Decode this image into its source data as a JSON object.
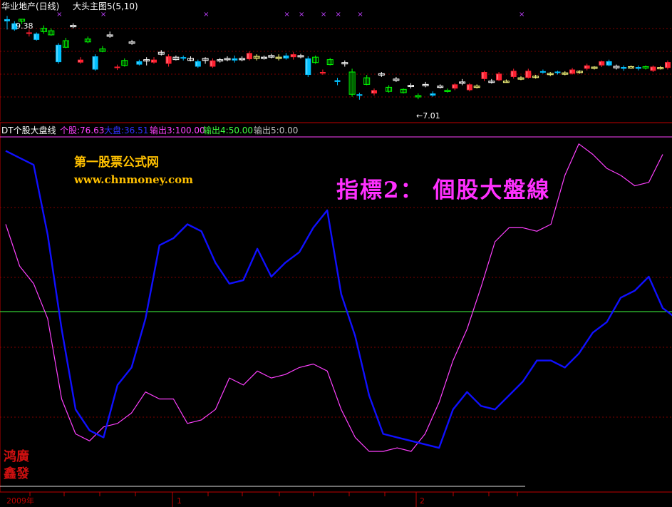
{
  "main_header": {
    "title": "华业地产(日线)",
    "indicator": "大头主图5(5,10)"
  },
  "markers": {
    "high": "9.38",
    "low": "←7.01"
  },
  "indicator_header": {
    "name": "DT个股大盘线",
    "items": [
      {
        "label": "个股",
        "value": "76.63",
        "color": "#ff40ff"
      },
      {
        "label": "大盘",
        "value": "36.51",
        "color": "#3030ff"
      },
      {
        "label": "输出3",
        "value": "100.00",
        "color": "#ff40ff"
      },
      {
        "label": "输出4",
        "value": "50.00",
        "color": "#40ff40"
      },
      {
        "label": "输出5",
        "value": "0.00",
        "color": "#c0c0c0"
      }
    ]
  },
  "watermark": {
    "site_name": "第一股票公式网",
    "url": "www.chnmoney.com",
    "caption": "指標2： 個股大盤線"
  },
  "logo_seal": "鸿广鑫发",
  "time_axis": {
    "year": "2009年",
    "m1": "1",
    "m2": "2"
  },
  "colors": {
    "up": "#ff2030",
    "down": "#00c0ff",
    "green": "#00ff00",
    "white": "#ffffff",
    "pink": "#ff40ff",
    "blue": "#1010ff",
    "line50": "#40ff40",
    "divider": "#c00000"
  },
  "chart_data": [
    {
      "type": "candlestick",
      "title": "华业地产(日线) 大头主图5(5,10)",
      "annotations": [
        {
          "label": "9.38",
          "kind": "high"
        },
        {
          "label": "7.01",
          "kind": "low"
        }
      ],
      "candles": [
        {
          "o": 9.25,
          "h": 9.38,
          "l": 9.05,
          "c": 9.3,
          "k": "c"
        },
        {
          "o": 9.2,
          "h": 9.25,
          "l": 9.02,
          "c": 9.05,
          "k": "c"
        },
        {
          "o": 9.25,
          "h": 9.3,
          "l": 9.18,
          "c": 9.3,
          "k": "g"
        },
        {
          "o": 8.95,
          "h": 9.05,
          "l": 8.88,
          "c": 8.98,
          "k": "r"
        },
        {
          "o": 8.95,
          "h": 8.98,
          "l": 8.78,
          "c": 8.8,
          "k": "c"
        },
        {
          "o": 9.08,
          "h": 9.15,
          "l": 8.95,
          "c": 9.0,
          "k": "g"
        },
        {
          "o": 9.02,
          "h": 9.08,
          "l": 8.9,
          "c": 8.92,
          "k": "g"
        },
        {
          "o": 8.68,
          "h": 8.72,
          "l": 8.22,
          "c": 8.26,
          "k": "c"
        },
        {
          "o": 8.78,
          "h": 8.85,
          "l": 8.6,
          "c": 8.62,
          "k": "g"
        },
        {
          "o": 9.15,
          "h": 9.2,
          "l": 9.08,
          "c": 9.12,
          "k": "w"
        },
        {
          "o": 8.32,
          "h": 8.38,
          "l": 8.22,
          "c": 8.25,
          "k": "r"
        },
        {
          "o": 8.82,
          "h": 8.88,
          "l": 8.72,
          "c": 8.75,
          "k": "g"
        },
        {
          "o": 8.4,
          "h": 8.45,
          "l": 8.05,
          "c": 8.08,
          "k": "c"
        },
        {
          "o": 8.58,
          "h": 8.65,
          "l": 8.5,
          "c": 8.52,
          "k": "g"
        },
        {
          "o": 8.92,
          "h": 9.0,
          "l": 8.85,
          "c": 8.9,
          "k": "w"
        },
        {
          "o": 8.15,
          "h": 8.2,
          "l": 8.07,
          "c": 8.12,
          "k": "r"
        },
        {
          "o": 8.3,
          "h": 8.35,
          "l": 8.15,
          "c": 8.18,
          "k": "g"
        },
        {
          "o": 8.72,
          "h": 8.8,
          "l": 8.68,
          "c": 8.75,
          "k": "w"
        },
        {
          "o": 8.28,
          "h": 8.32,
          "l": 8.18,
          "c": 8.2,
          "k": "c"
        },
        {
          "o": 8.3,
          "h": 8.38,
          "l": 8.18,
          "c": 8.32,
          "k": "w"
        },
        {
          "o": 8.32,
          "h": 8.38,
          "l": 8.22,
          "c": 8.25,
          "k": "r"
        },
        {
          "o": 8.5,
          "h": 8.55,
          "l": 8.42,
          "c": 8.45,
          "k": "w"
        },
        {
          "o": 8.4,
          "h": 8.45,
          "l": 8.15,
          "c": 8.22,
          "k": "r"
        },
        {
          "o": 8.38,
          "h": 8.42,
          "l": 8.3,
          "c": 8.32,
          "k": "w"
        },
        {
          "o": 8.35,
          "h": 8.42,
          "l": 8.3,
          "c": 8.38,
          "k": "c"
        },
        {
          "o": 8.35,
          "h": 8.4,
          "l": 8.28,
          "c": 8.3,
          "k": "w"
        },
        {
          "o": 8.28,
          "h": 8.32,
          "l": 8.12,
          "c": 8.15,
          "k": "c"
        },
        {
          "o": 8.35,
          "h": 8.38,
          "l": 8.22,
          "c": 8.3,
          "k": "w"
        },
        {
          "o": 8.15,
          "h": 8.35,
          "l": 8.12,
          "c": 8.3,
          "k": "r"
        },
        {
          "o": 8.3,
          "h": 8.36,
          "l": 8.25,
          "c": 8.32,
          "k": "w"
        },
        {
          "o": 8.35,
          "h": 8.4,
          "l": 8.28,
          "c": 8.32,
          "k": "w"
        },
        {
          "o": 8.35,
          "h": 8.42,
          "l": 8.25,
          "c": 8.3,
          "k": "c"
        },
        {
          "o": 8.32,
          "h": 8.4,
          "l": 8.28,
          "c": 8.35,
          "k": "w"
        },
        {
          "o": 8.48,
          "h": 8.52,
          "l": 8.3,
          "c": 8.33,
          "k": "r"
        },
        {
          "o": 8.4,
          "h": 8.45,
          "l": 8.3,
          "c": 8.35,
          "k": "y"
        },
        {
          "o": 8.38,
          "h": 8.42,
          "l": 8.32,
          "c": 8.36,
          "k": "w"
        },
        {
          "o": 8.42,
          "h": 8.46,
          "l": 8.35,
          "c": 8.38,
          "k": "w"
        },
        {
          "o": 8.38,
          "h": 8.45,
          "l": 8.3,
          "c": 8.35,
          "k": "y"
        },
        {
          "o": 8.42,
          "h": 8.48,
          "l": 8.32,
          "c": 8.35,
          "k": "c"
        },
        {
          "o": 8.38,
          "h": 8.5,
          "l": 8.32,
          "c": 8.45,
          "k": "r"
        },
        {
          "o": 8.42,
          "h": 8.46,
          "l": 8.35,
          "c": 8.4,
          "k": "w"
        },
        {
          "o": 8.35,
          "h": 8.4,
          "l": 7.9,
          "c": 7.95,
          "k": "c"
        },
        {
          "o": 8.38,
          "h": 8.42,
          "l": 8.22,
          "c": 8.25,
          "k": "g"
        },
        {
          "o": 8.02,
          "h": 8.08,
          "l": 7.95,
          "c": 8.0,
          "k": "r"
        },
        {
          "o": 8.32,
          "h": 8.36,
          "l": 8.18,
          "c": 8.2,
          "k": "g"
        },
        {
          "o": 7.82,
          "h": 7.88,
          "l": 7.7,
          "c": 7.78,
          "k": "c"
        },
        {
          "o": 8.25,
          "h": 8.3,
          "l": 8.15,
          "c": 8.22,
          "k": "w"
        },
        {
          "o": 8.02,
          "h": 8.1,
          "l": 7.42,
          "c": 7.48,
          "k": "g"
        },
        {
          "o": 7.48,
          "h": 7.52,
          "l": 7.35,
          "c": 7.45,
          "k": "c"
        },
        {
          "o": 7.88,
          "h": 7.95,
          "l": 7.7,
          "c": 7.72,
          "k": "g"
        },
        {
          "o": 7.5,
          "h": 7.62,
          "l": 7.45,
          "c": 7.58,
          "k": "r"
        },
        {
          "o": 7.98,
          "h": 8.02,
          "l": 7.9,
          "c": 7.95,
          "k": "w"
        },
        {
          "o": 7.65,
          "h": 7.7,
          "l": 7.52,
          "c": 7.55,
          "k": "g"
        },
        {
          "o": 7.85,
          "h": 7.9,
          "l": 7.78,
          "c": 7.82,
          "k": "w"
        },
        {
          "o": 7.6,
          "h": 7.62,
          "l": 7.5,
          "c": 7.52,
          "k": "g"
        },
        {
          "o": 7.68,
          "h": 7.75,
          "l": 7.62,
          "c": 7.7,
          "k": "w"
        },
        {
          "o": 7.45,
          "h": 7.5,
          "l": 7.36,
          "c": 7.42,
          "k": "g"
        },
        {
          "o": 7.72,
          "h": 7.78,
          "l": 7.65,
          "c": 7.7,
          "k": "w"
        },
        {
          "o": 7.5,
          "h": 7.55,
          "l": 7.42,
          "c": 7.45,
          "k": "c"
        },
        {
          "o": 7.68,
          "h": 7.72,
          "l": 7.62,
          "c": 7.65,
          "k": "w"
        },
        {
          "o": 7.58,
          "h": 7.62,
          "l": 7.52,
          "c": 7.55,
          "k": "g"
        },
        {
          "o": 7.62,
          "h": 7.75,
          "l": 7.58,
          "c": 7.72,
          "k": "r"
        },
        {
          "o": 7.78,
          "h": 7.85,
          "l": 7.7,
          "c": 7.75,
          "k": "w"
        },
        {
          "o": 7.58,
          "h": 7.75,
          "l": 7.55,
          "c": 7.72,
          "k": "r"
        },
        {
          "o": 7.68,
          "h": 7.72,
          "l": 7.62,
          "c": 7.66,
          "k": "y"
        },
        {
          "o": 7.85,
          "h": 8.05,
          "l": 7.8,
          "c": 8.02,
          "k": "r"
        },
        {
          "o": 7.8,
          "h": 7.85,
          "l": 7.74,
          "c": 7.78,
          "k": "w"
        },
        {
          "o": 7.82,
          "h": 8.02,
          "l": 7.8,
          "c": 7.98,
          "k": "r"
        },
        {
          "o": 7.8,
          "h": 7.84,
          "l": 7.76,
          "c": 7.8,
          "k": "y"
        },
        {
          "o": 7.9,
          "h": 8.1,
          "l": 7.86,
          "c": 8.05,
          "k": "r"
        },
        {
          "o": 7.88,
          "h": 7.92,
          "l": 7.82,
          "c": 7.86,
          "k": "y"
        },
        {
          "o": 7.88,
          "h": 8.1,
          "l": 7.86,
          "c": 8.05,
          "k": "r"
        },
        {
          "o": 7.9,
          "h": 7.95,
          "l": 7.86,
          "c": 7.92,
          "k": "y"
        },
        {
          "o": 8.02,
          "h": 8.08,
          "l": 7.98,
          "c": 8.04,
          "k": "c"
        },
        {
          "o": 7.96,
          "h": 8.02,
          "l": 7.92,
          "c": 7.99,
          "k": "y"
        },
        {
          "o": 8.0,
          "h": 8.05,
          "l": 7.96,
          "c": 8.03,
          "k": "c"
        },
        {
          "o": 7.98,
          "h": 8.04,
          "l": 7.94,
          "c": 8.0,
          "k": "y"
        },
        {
          "o": 7.98,
          "h": 8.12,
          "l": 7.96,
          "c": 8.08,
          "k": "r"
        },
        {
          "o": 8.02,
          "h": 8.06,
          "l": 7.98,
          "c": 8.04,
          "k": "y"
        },
        {
          "o": 8.1,
          "h": 8.22,
          "l": 8.06,
          "c": 8.18,
          "k": "r"
        },
        {
          "o": 8.12,
          "h": 8.16,
          "l": 8.08,
          "c": 8.14,
          "k": "y"
        },
        {
          "o": 8.18,
          "h": 8.3,
          "l": 8.14,
          "c": 8.28,
          "k": "r"
        },
        {
          "o": 8.28,
          "h": 8.32,
          "l": 8.16,
          "c": 8.18,
          "k": "c"
        },
        {
          "o": 8.16,
          "h": 8.2,
          "l": 8.08,
          "c": 8.12,
          "k": "w"
        },
        {
          "o": 8.1,
          "h": 8.18,
          "l": 8.05,
          "c": 8.14,
          "k": "c"
        },
        {
          "o": 8.14,
          "h": 8.18,
          "l": 8.1,
          "c": 8.15,
          "k": "y"
        },
        {
          "o": 8.14,
          "h": 8.18,
          "l": 8.06,
          "c": 8.1,
          "k": "c"
        },
        {
          "o": 8.12,
          "h": 8.18,
          "l": 8.08,
          "c": 8.15,
          "k": "g"
        },
        {
          "o": 8.05,
          "h": 8.18,
          "l": 8.02,
          "c": 8.15,
          "k": "r"
        },
        {
          "o": 8.12,
          "h": 8.16,
          "l": 8.08,
          "c": 8.13,
          "k": "y"
        },
        {
          "o": 8.12,
          "h": 8.3,
          "l": 8.08,
          "c": 8.26,
          "k": "r"
        }
      ],
      "signals": [
        7,
        13,
        27,
        38,
        40,
        43,
        45,
        48,
        70
      ]
    },
    {
      "type": "line",
      "title": "DT个股大盘线",
      "ylim": [
        0,
        100
      ],
      "reference_lines": [
        {
          "name": "输出3",
          "value": 100,
          "color": "#ff40ff"
        },
        {
          "name": "输出4",
          "value": 50,
          "color": "#40ff40"
        },
        {
          "name": "输出5",
          "value": 0,
          "color": "#c0c0c0"
        }
      ],
      "x": [
        0,
        1,
        2,
        3,
        4,
        5,
        6,
        7,
        8,
        9,
        10,
        11,
        12,
        13,
        14,
        15,
        16,
        17,
        18,
        19,
        20,
        21,
        22,
        23,
        24,
        25,
        26,
        27,
        28,
        29,
        30,
        31,
        32,
        33,
        34,
        35,
        36,
        37,
        38,
        39,
        40,
        41,
        42,
        43,
        44,
        45,
        46,
        47,
        48,
        49,
        50,
        51,
        52,
        53,
        54,
        55,
        56,
        57,
        58,
        59,
        60,
        61,
        62,
        63,
        64,
        65,
        66,
        67,
        68,
        69,
        70,
        71,
        72
      ],
      "series": [
        {
          "name": "个股",
          "color": "#ff40ff",
          "values": [
            75,
            63,
            58,
            48,
            25,
            15,
            13,
            17,
            18,
            21,
            27,
            25,
            25,
            18,
            19,
            22,
            31,
            29,
            33,
            31,
            32,
            34,
            35,
            33,
            22,
            14,
            10,
            10,
            11,
            10,
            15,
            24,
            36,
            45,
            57,
            70,
            74,
            74,
            73,
            75,
            89,
            98,
            95,
            91,
            89,
            86,
            87,
            95
          ]
        },
        {
          "name": "大盘",
          "color": "#1010ff",
          "values": [
            96,
            94,
            92,
            72,
            45,
            22,
            16,
            14,
            29,
            34,
            48,
            69,
            71,
            75,
            73,
            64,
            58,
            59,
            68,
            60,
            64,
            67,
            74,
            79,
            55,
            43,
            26,
            15,
            14,
            13,
            12,
            11,
            22,
            27,
            23,
            22,
            26,
            30,
            36,
            36,
            34,
            38,
            44,
            47,
            54,
            56,
            60,
            51,
            48
          ]
        }
      ]
    }
  ]
}
